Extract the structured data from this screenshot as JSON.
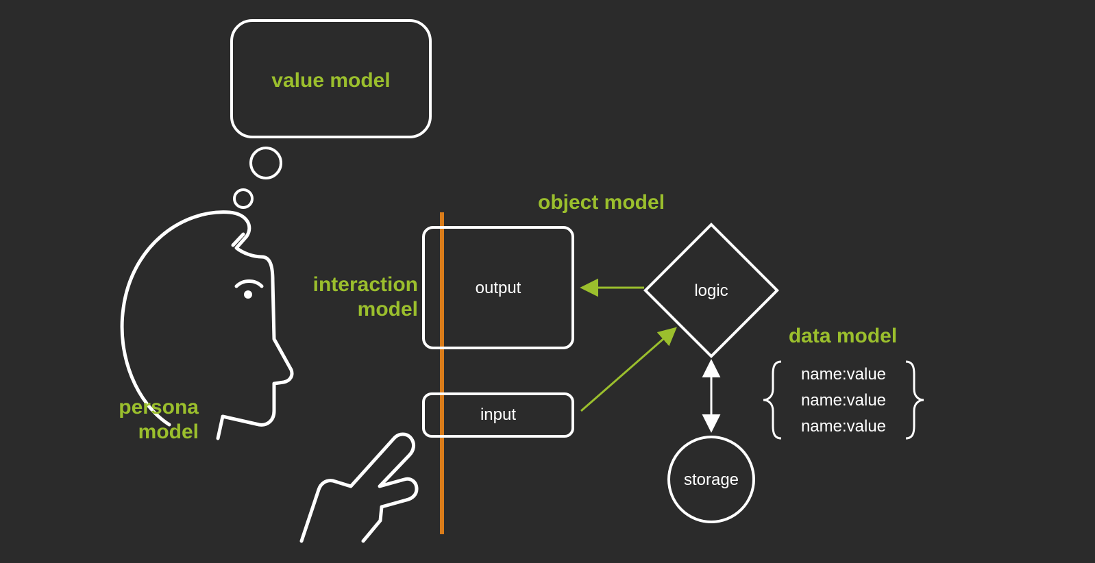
{
  "labels": {
    "value_model": "value model",
    "interaction_model_l1": "interaction",
    "interaction_model_l2": "model",
    "object_model": "object model",
    "persona_model_l1": "persona",
    "persona_model_l2": "model",
    "data_model": "data model"
  },
  "nodes": {
    "output": "output",
    "input": "input",
    "logic": "logic",
    "storage": "storage"
  },
  "data_pairs": {
    "p1": "name:value",
    "p2": "name:value",
    "p3": "name:value"
  },
  "colors": {
    "bg": "#2b2b2b",
    "olive": "#9bbf2d",
    "white": "#ffffff",
    "orange": "#d97c1a"
  }
}
